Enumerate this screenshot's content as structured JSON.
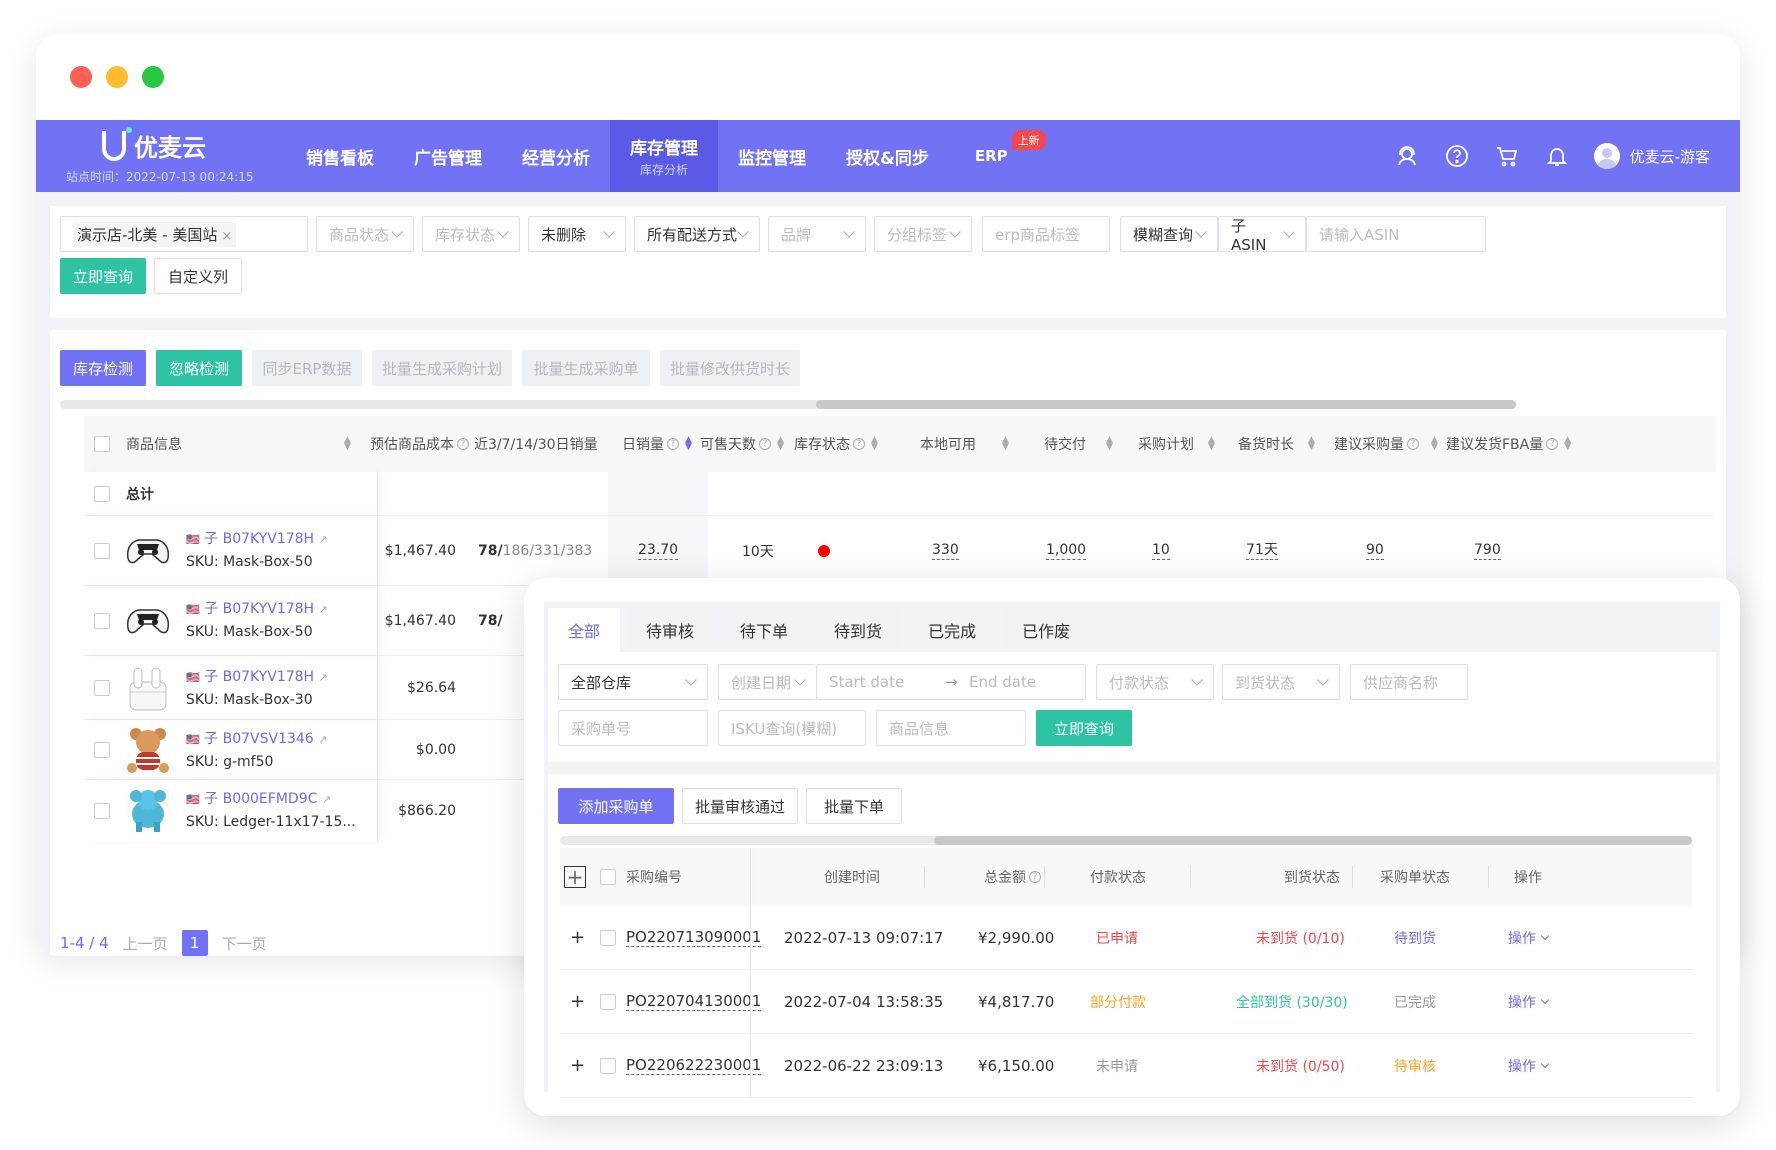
{
  "colors": {
    "primary": "#7272f5",
    "accent_green": "#2ec4a3",
    "red": "#f04848",
    "orange": "#f5a623"
  },
  "nav": {
    "logo": "优麦云",
    "site_time": "站点时间：2022-07-13 00:24:15",
    "menu": [
      {
        "label": "销售看板"
      },
      {
        "label": "广告管理"
      },
      {
        "label": "经营分析"
      },
      {
        "label": "库存管理",
        "sub": "库存分析"
      },
      {
        "label": "监控管理"
      },
      {
        "label": "授权&同步"
      },
      {
        "label": "ERP",
        "badge": "上新"
      }
    ],
    "user": "优麦云-游客"
  },
  "filters": {
    "shop_tag": "演示店-北美 - 美国站",
    "product_status": "商品状态",
    "stock_status": "库存状态",
    "deleted": "未删除",
    "delivery": "所有配送方式",
    "brand": "品牌",
    "group_tag": "分组标签",
    "erp_tag": "erp商品标签",
    "fuzzy": "模糊查询",
    "asin_type": "子 ASIN",
    "asin_placeholder": "请输入ASIN",
    "query_btn": "立即查询",
    "custom_cols": "自定义列"
  },
  "actions": {
    "stock_check": "库存检测",
    "ignore_check": "忽略检测",
    "sync_erp": "同步ERP数据",
    "batch_plan": "批量生成采购计划",
    "batch_po": "批量生成采购单",
    "batch_leadtime": "批量修改供货时长"
  },
  "table": {
    "headers": {
      "product": "商品信息",
      "cost": "预估商品成本",
      "sales": "近3/7/14/30日销量",
      "daily": "日销量",
      "days": "可售天数",
      "status": "库存状态",
      "local": "本地可用",
      "pending": "待交付",
      "plan": "采购计划",
      "lead": "备货时长",
      "suggest": "建议采购量",
      "fba": "建议发货FBA量"
    },
    "total_label": "总计",
    "rows": [
      {
        "asin": "子 B07KYV178H",
        "sku": "SKU: Mask-Box-50",
        "cost": "$1,467.40",
        "sales_bold": "78/",
        "sales_rest": "186/331/383",
        "daily": "23.70",
        "days": "10天",
        "local": "330",
        "pending": "1,000",
        "plan": "10",
        "lead": "71天",
        "suggest": "90",
        "fba": "790"
      },
      {
        "asin": "子 B07KYV178H",
        "sku": "SKU: Mask-Box-50",
        "cost": "$1,467.40",
        "sales_bold": "78/"
      },
      {
        "asin": "子 B07KYV178H",
        "sku": "SKU: Mask-Box-30",
        "cost": "$26.64"
      },
      {
        "asin": "子 B07VSV1346",
        "sku": "SKU: g-mf50",
        "cost": "$0.00"
      },
      {
        "asin": "子 B000EFMD9C",
        "sku": "SKU: Ledger-11x17-15...",
        "cost": "$866.20"
      }
    ]
  },
  "pager": {
    "count": "1-4 / 4",
    "prev": "上一页",
    "page": "1",
    "next": "下一页"
  },
  "popup": {
    "tabs": [
      "全部",
      "待审核",
      "待下单",
      "待到货",
      "已完成",
      "已作废"
    ],
    "filters": {
      "warehouse": "全部仓库",
      "created": "创建日期",
      "start": "Start date",
      "end": "End date",
      "pay_status": "付款状态",
      "arrive_status": "到货状态",
      "supplier": "供应商名称",
      "po_no": "采购单号",
      "isku": "ISKU查询(模糊)",
      "product": "商品信息",
      "query_btn": "立即查询"
    },
    "buttons": {
      "add": "添加采购单",
      "batch_approve": "批量审核通过",
      "batch_order": "批量下单"
    },
    "headers": {
      "po": "采购编号",
      "time": "创建时间",
      "amount": "总金额",
      "pay": "付款状态",
      "arrive": "到货状态",
      "status": "采购单状态",
      "op": "操作"
    },
    "rows": [
      {
        "po": "PO220713090001",
        "time": "2022-07-13 09:07:17",
        "amount": "¥2,990.00",
        "pay": "已申请",
        "arrive": "未到货 (0/10)",
        "status": "待到货",
        "op": "操作"
      },
      {
        "po": "PO220704130001",
        "time": "2022-07-04 13:58:35",
        "amount": "¥4,817.70",
        "pay": "部分付款",
        "arrive": "全部到货 (30/30)",
        "status": "已完成",
        "op": "操作"
      },
      {
        "po": "PO220622230001",
        "time": "2022-06-22 23:09:13",
        "amount": "¥6,150.00",
        "pay": "未申请",
        "arrive": "未到货 (0/50)",
        "status": "待审核",
        "op": "操作"
      }
    ]
  }
}
